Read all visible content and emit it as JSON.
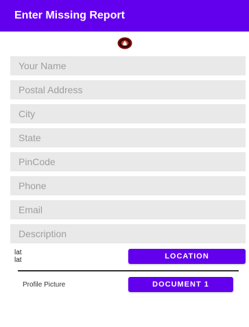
{
  "app_bar": {
    "title": "Enter Missing Report"
  },
  "form": {
    "fields": [
      {
        "placeholder": "Your Name",
        "value": ""
      },
      {
        "placeholder": "Postal Address",
        "value": ""
      },
      {
        "placeholder": "City",
        "value": ""
      },
      {
        "placeholder": "State",
        "value": ""
      },
      {
        "placeholder": "PinCode",
        "value": ""
      },
      {
        "placeholder": "Phone",
        "value": ""
      },
      {
        "placeholder": "Email",
        "value": ""
      },
      {
        "placeholder": "Description",
        "value": ""
      }
    ],
    "lat_line_1": "lat",
    "lat_line_2": "lat",
    "location_button": "LOCATION",
    "profile_picture_label": "Profile Picture",
    "document_button": "DOCUMENT 1"
  },
  "colors": {
    "primary": "#6200ee",
    "field_background": "#e9e9e9",
    "logo_ring": "#7a0b0b"
  },
  "icons": {
    "logo": "emblem-logo-icon"
  }
}
